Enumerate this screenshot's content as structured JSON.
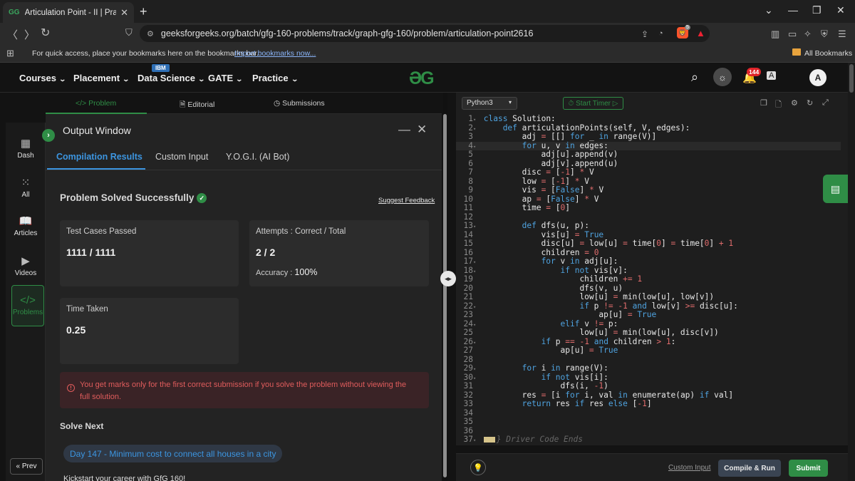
{
  "browser": {
    "tab_title": "Articulation Point - II | Practice",
    "tab_favicon": "GG",
    "url": "geeksforgeeks.org/batch/gfg-160-problems/track/graph-gfg-160/problem/articulation-point2616",
    "bookmarks_prompt": "For quick access, place your bookmarks here on the bookmarks bar.",
    "import_bookmarks": "Import bookmarks now...",
    "all_bookmarks": "All Bookmarks",
    "extension_badge": "5"
  },
  "header": {
    "menu": [
      "Courses",
      "Placement",
      "Data Science",
      "GATE",
      "Practice"
    ],
    "ibm_badge": "IBM",
    "notification_count": "144",
    "avatar_letter": "A"
  },
  "leftnav": {
    "items": [
      "Dash",
      "All",
      "Articles",
      "Videos",
      "Problems"
    ],
    "prev": "« Prev"
  },
  "problem_tabs": [
    "Problem",
    "Editorial",
    "Submissions"
  ],
  "output": {
    "title": "Output Window",
    "tabs": [
      "Compilation Results",
      "Custom Input",
      "Y.O.G.I. (AI Bot)"
    ],
    "status": "Problem Solved Successfully",
    "feedback": "Suggest Feedback",
    "test_cases_label": "Test Cases Passed",
    "test_cases_value": "1111 / 1111",
    "attempts_label": "Attempts : Correct / Total",
    "attempts_value": "2 / 2",
    "accuracy_label": "Accuracy :",
    "accuracy_value": "100%",
    "time_label": "Time Taken",
    "time_value": "0.25",
    "warning": "You get marks only for the first correct submission if you solve the problem without viewing the full solution.",
    "solve_next": "Solve Next",
    "next_problem": "Day 147 - Minimum cost to connect all houses in a city",
    "cut_text": "Kickstart your career with GfG 160!"
  },
  "editor": {
    "language": "Python3",
    "timer": "Start Timer",
    "driver_code": "} Driver Code Ends",
    "custom_input": "Custom Input",
    "compile": "Compile & Run",
    "submit": "Submit"
  },
  "code_lines": [
    "class Solution:",
    "    def articulationPoints(self, V, edges):",
    "        adj = [[] for _ in range(V)]",
    "        for u, v in edges:",
    "            adj[u].append(v)",
    "            adj[v].append(u)",
    "        disc = [-1] * V",
    "        low = [-1] * V",
    "        vis = [False] * V",
    "        ap = [False] * V",
    "        time = [0]",
    "",
    "        def dfs(u, p):",
    "            vis[u] = True",
    "            disc[u] = low[u] = time[0] = time[0] + 1",
    "            children = 0",
    "            for v in adj[u]:",
    "                if not vis[v]:",
    "                    children += 1",
    "                    dfs(v, u)",
    "                    low[u] = min(low[u], low[v])",
    "                    if p != -1 and low[v] >= disc[u]:",
    "                        ap[u] = True",
    "                elif v != p:",
    "                    low[u] = min(low[u], disc[v])",
    "            if p == -1 and children > 1:",
    "                ap[u] = True",
    "",
    "        for i in range(V):",
    "            if not vis[i]:",
    "                dfs(i, -1)",
    "        res = [i for i, val in enumerate(ap) if val]",
    "        return res if res else [-1]",
    "",
    "",
    "",
    ""
  ],
  "folded_lines": [
    1,
    2,
    4,
    13,
    17,
    18,
    22,
    24,
    26,
    29,
    30,
    37
  ],
  "highlight_line": 4
}
